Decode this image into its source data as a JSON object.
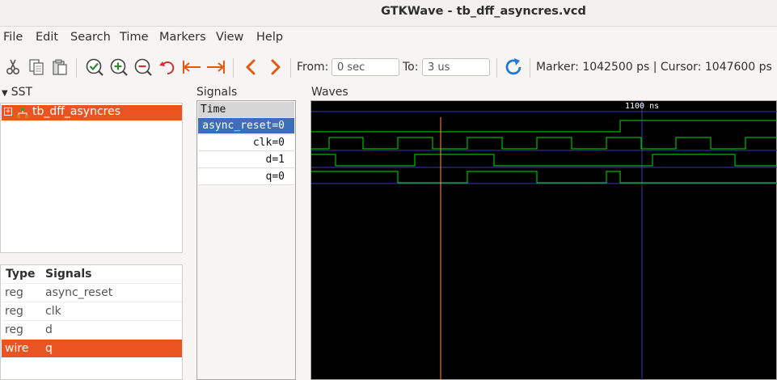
{
  "window": {
    "title": "GTKWave - tb_dff_asyncres.vcd"
  },
  "menu": [
    "File",
    "Edit",
    "Search",
    "Time",
    "Markers",
    "View",
    "Help"
  ],
  "toolbar": {
    "from_label": "From:",
    "from_value": "0 sec",
    "to_label": "To:",
    "to_value": "3 us",
    "marker_text": "Marker: 1042500 ps  |  Cursor: 1047600 ps",
    "icons": [
      "cut-icon",
      "copy-icon",
      "paste-icon",
      "zoom-fit-icon",
      "zoom-in-icon",
      "zoom-out-icon",
      "undo-icon",
      "zoom-start-icon",
      "zoom-end-icon",
      "page-left-icon",
      "page-right-icon",
      "reload-icon"
    ]
  },
  "sst": {
    "label": "SST",
    "tree_item": "tb_dff_asyncres",
    "table_headers": {
      "type": "Type",
      "signals": "Signals"
    },
    "rows": [
      {
        "type": "reg",
        "name": "async_reset",
        "selected": false
      },
      {
        "type": "reg",
        "name": "clk",
        "selected": false
      },
      {
        "type": "reg",
        "name": "d",
        "selected": false
      },
      {
        "type": "wire",
        "name": "q",
        "selected": true
      }
    ]
  },
  "signals": {
    "label": "Signals",
    "time_header": "Time",
    "entries": [
      {
        "name": "async_reset",
        "value": "0",
        "display": "async_reset=0",
        "selected": true
      },
      {
        "name": "clk",
        "value": "0",
        "display": "clk=0",
        "selected": false
      },
      {
        "name": "d",
        "value": "1",
        "display": "d=1",
        "selected": false
      },
      {
        "name": "q",
        "value": "0",
        "display": "q=0",
        "selected": false
      }
    ]
  },
  "waves": {
    "label": "Waves",
    "time_marker_label": "1100 ns",
    "wave_color": "#00e000",
    "marker_color": "#ff8c4a",
    "grid_color": "#3a3ab0"
  },
  "colors": {
    "accent": "#e95420",
    "selection_blue": "#3d6fb8"
  }
}
